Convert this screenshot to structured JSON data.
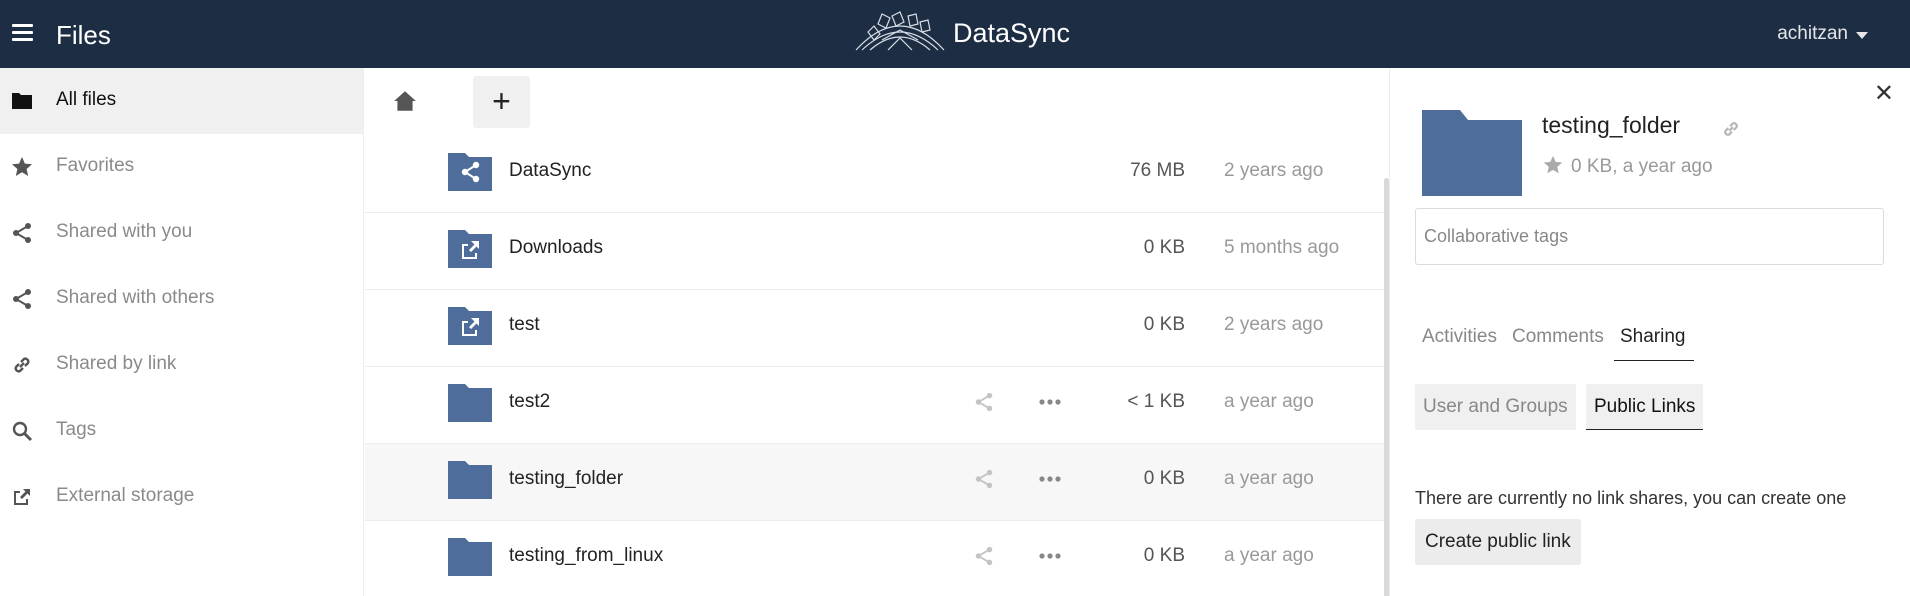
{
  "header": {
    "app_title": "Files",
    "brand": "DataSync",
    "user": "achitzan"
  },
  "sidebar": {
    "items": [
      {
        "label": "All files",
        "icon": "folder-icon",
        "active": true
      },
      {
        "label": "Favorites",
        "icon": "star-icon"
      },
      {
        "label": "Shared with you",
        "icon": "share-icon"
      },
      {
        "label": "Shared with others",
        "icon": "share-icon"
      },
      {
        "label": "Shared by link",
        "icon": "link-icon"
      },
      {
        "label": "Tags",
        "icon": "search-icon"
      },
      {
        "label": "External storage",
        "icon": "external-link-icon"
      }
    ]
  },
  "files": {
    "new_label": "+",
    "rows": [
      {
        "name": "DataSync",
        "size": "76 MB",
        "date": "2 years ago",
        "icon": "shared-folder-icon"
      },
      {
        "name": "Downloads",
        "size": "0 KB",
        "date": "5 months ago",
        "icon": "external-folder-icon"
      },
      {
        "name": "test",
        "size": "0 KB",
        "date": "2 years ago",
        "icon": "external-folder-icon"
      },
      {
        "name": "test2",
        "size": "< 1 KB",
        "date": "a year ago",
        "icon": "folder-icon"
      },
      {
        "name": "testing_folder",
        "size": "0 KB",
        "date": "a year ago",
        "icon": "folder-icon",
        "selected": true
      },
      {
        "name": "testing_from_linux",
        "size": "0 KB",
        "date": "a year ago",
        "icon": "folder-icon"
      }
    ]
  },
  "details": {
    "name": "testing_folder",
    "meta": "0 KB, a year ago",
    "tags_placeholder": "Collaborative tags",
    "tabs": [
      "Activities",
      "Comments",
      "Sharing"
    ],
    "active_tab": "Sharing",
    "subtabs": [
      "User and Groups",
      "Public Links"
    ],
    "active_subtab": "Public Links",
    "empty_message": "There are currently no link shares, you can create one",
    "create_link_label": "Create public link"
  },
  "colors": {
    "header_bg": "#1d2d44",
    "folder": "#4f6d9a"
  }
}
